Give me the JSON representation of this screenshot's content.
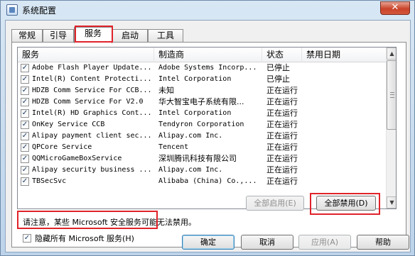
{
  "window": {
    "title": "系统配置",
    "close_label": "✕",
    "tabs": [
      {
        "label": "常规"
      },
      {
        "label": "引导"
      },
      {
        "label": "服务"
      },
      {
        "label": "启动"
      },
      {
        "label": "工具"
      }
    ],
    "active_tab": "服务"
  },
  "services": {
    "columns": [
      "服务",
      "制造商",
      "状态",
      "禁用日期"
    ],
    "rows": [
      {
        "name": "Adobe Flash Player Update...",
        "maker": "Adobe Systems Incorp...",
        "status": "已停止",
        "date": "",
        "checked": true
      },
      {
        "name": "Intel(R) Content Protecti...",
        "maker": "Intel Corporation",
        "status": "已停止",
        "date": "",
        "checked": true
      },
      {
        "name": "HDZB Comm Service For CCB...",
        "maker": "未知",
        "status": "正在运行",
        "date": "",
        "checked": true
      },
      {
        "name": "HDZB Comm Service For V2.0",
        "maker": "华大智宝电子系统有限...",
        "status": "正在运行",
        "date": "",
        "checked": true
      },
      {
        "name": "Intel(R) HD Graphics Cont...",
        "maker": "Intel Corporation",
        "status": "正在运行",
        "date": "",
        "checked": true
      },
      {
        "name": "OnKey Service CCB",
        "maker": "Tendyron Corporation",
        "status": "正在运行",
        "date": "",
        "checked": true
      },
      {
        "name": "Alipay payment client sec...",
        "maker": "Alipay.com Inc.",
        "status": "正在运行",
        "date": "",
        "checked": true
      },
      {
        "name": "QPCore Service",
        "maker": "Tencent",
        "status": "正在运行",
        "date": "",
        "checked": true
      },
      {
        "name": "QQMicroGameBoxService",
        "maker": "深圳腾讯科技有限公司",
        "status": "正在运行",
        "date": "",
        "checked": true
      },
      {
        "name": "Alipay security business ...",
        "maker": "Alipay.com Inc.",
        "status": "正在运行",
        "date": "",
        "checked": true
      },
      {
        "name": "TBSecSvc",
        "maker": "Alibaba (China) Co.,...",
        "status": "正在运行",
        "date": "",
        "checked": true
      }
    ]
  },
  "notice": "请注意，某些 Microsoft 安全服务可能无法禁用。",
  "buttons": {
    "enable_all": "全部启用(E)",
    "disable_all": "全部禁用(D)",
    "ok": "确定",
    "cancel": "取消",
    "apply": "应用(A)",
    "help": "帮助"
  },
  "hide_microsoft": {
    "label": "隐藏所有 Microsoft 服务(H)",
    "checked": true
  },
  "colors": {
    "highlight": "#e0232a"
  }
}
